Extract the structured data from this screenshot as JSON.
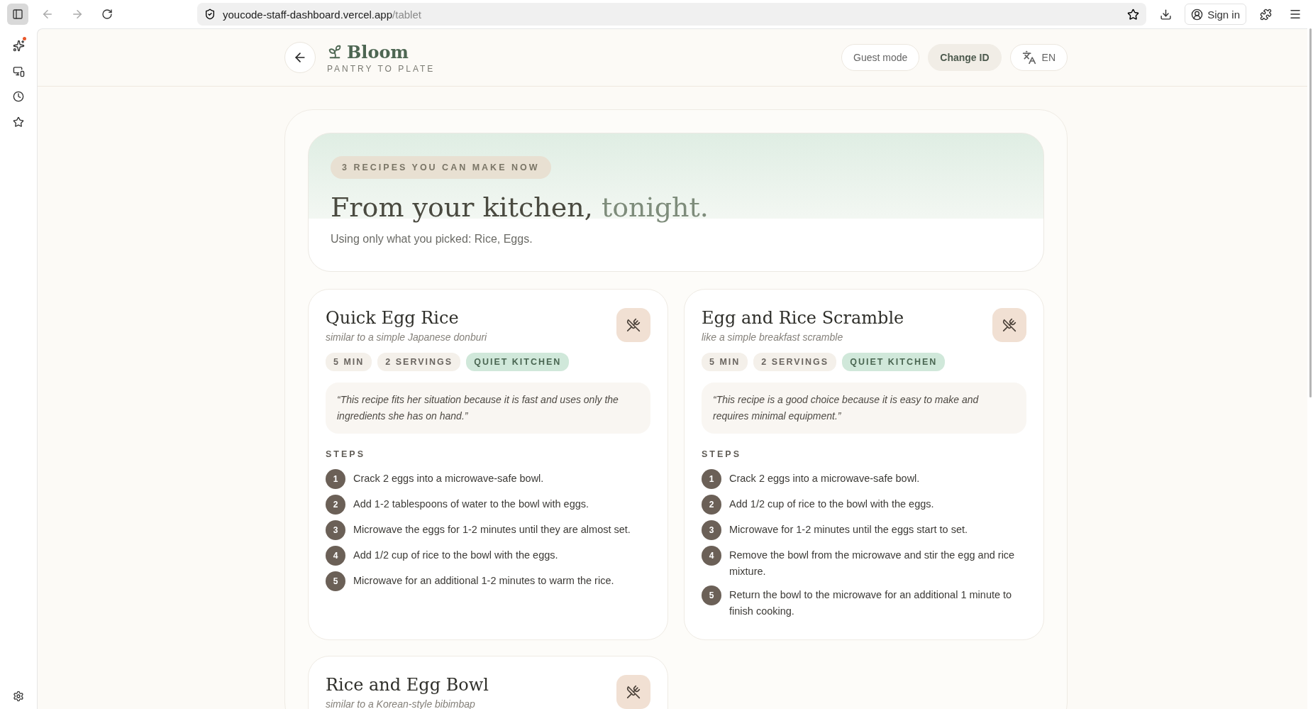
{
  "browser": {
    "url_host": "youcode-staff-dashboard.vercel.app",
    "url_path": "/tablet",
    "sign_in": "Sign in"
  },
  "header": {
    "brand": "Bloom",
    "tagline": "PANTRY TO PLATE",
    "buttons": [
      {
        "label": "Guest mode",
        "kind": "outline"
      },
      {
        "label": "Change ID",
        "kind": "filled"
      },
      {
        "label": "EN",
        "kind": "language"
      }
    ]
  },
  "hero": {
    "badge": "3 RECIPES YOU CAN MAKE NOW",
    "title": "From your kitchen,",
    "title_accent": "tonight.",
    "subtitle": "Using only what you picked: Rice, Eggs."
  },
  "recipes": [
    {
      "title": "Quick Egg Rice",
      "subtitle": "similar to a simple Japanese donburi",
      "tags": [
        {
          "label": "5 MIN",
          "kind": "neutral"
        },
        {
          "label": "2 SERVINGS",
          "kind": "neutral"
        },
        {
          "label": "QUIET KITCHEN",
          "kind": "green"
        }
      ],
      "quote": "“This recipe fits her situation because it is fast and uses only the ingredients she has on hand.”",
      "steps_label": "STEPS",
      "steps": [
        {
          "number": "1",
          "text": "Crack 2 eggs into a microwave-safe bowl."
        },
        {
          "number": "2",
          "text": "Add 1-2 tablespoons of water to the bowl with eggs."
        },
        {
          "number": "3",
          "text": "Microwave the eggs for 1-2 minutes until they are almost set."
        },
        {
          "number": "4",
          "text": "Add 1/2 cup of rice to the bowl with the eggs."
        },
        {
          "number": "5",
          "text": "Microwave for an additional 1-2 minutes to warm the rice."
        }
      ]
    },
    {
      "title": "Egg and Rice Scramble",
      "subtitle": "like a simple breakfast scramble",
      "tags": [
        {
          "label": "5 MIN",
          "kind": "neutral"
        },
        {
          "label": "2 SERVINGS",
          "kind": "neutral"
        },
        {
          "label": "QUIET KITCHEN",
          "kind": "green"
        }
      ],
      "quote": "“This recipe is a good choice because it is easy to make and requires minimal equipment.”",
      "steps_label": "STEPS",
      "steps": [
        {
          "number": "1",
          "text": "Crack 2 eggs into a microwave-safe bowl."
        },
        {
          "number": "2",
          "text": "Add 1/2 cup of rice to the bowl with the eggs."
        },
        {
          "number": "3",
          "text": "Microwave for 1-2 minutes until the eggs start to set."
        },
        {
          "number": "4",
          "text": "Remove the bowl from the microwave and stir the egg and rice mixture."
        },
        {
          "number": "5",
          "text": "Return the bowl to the microwave for an additional 1 minute to finish cooking."
        }
      ]
    },
    {
      "title": "Rice and Egg Bowl",
      "subtitle": "similar to a Korean-style bibimbap"
    }
  ]
}
